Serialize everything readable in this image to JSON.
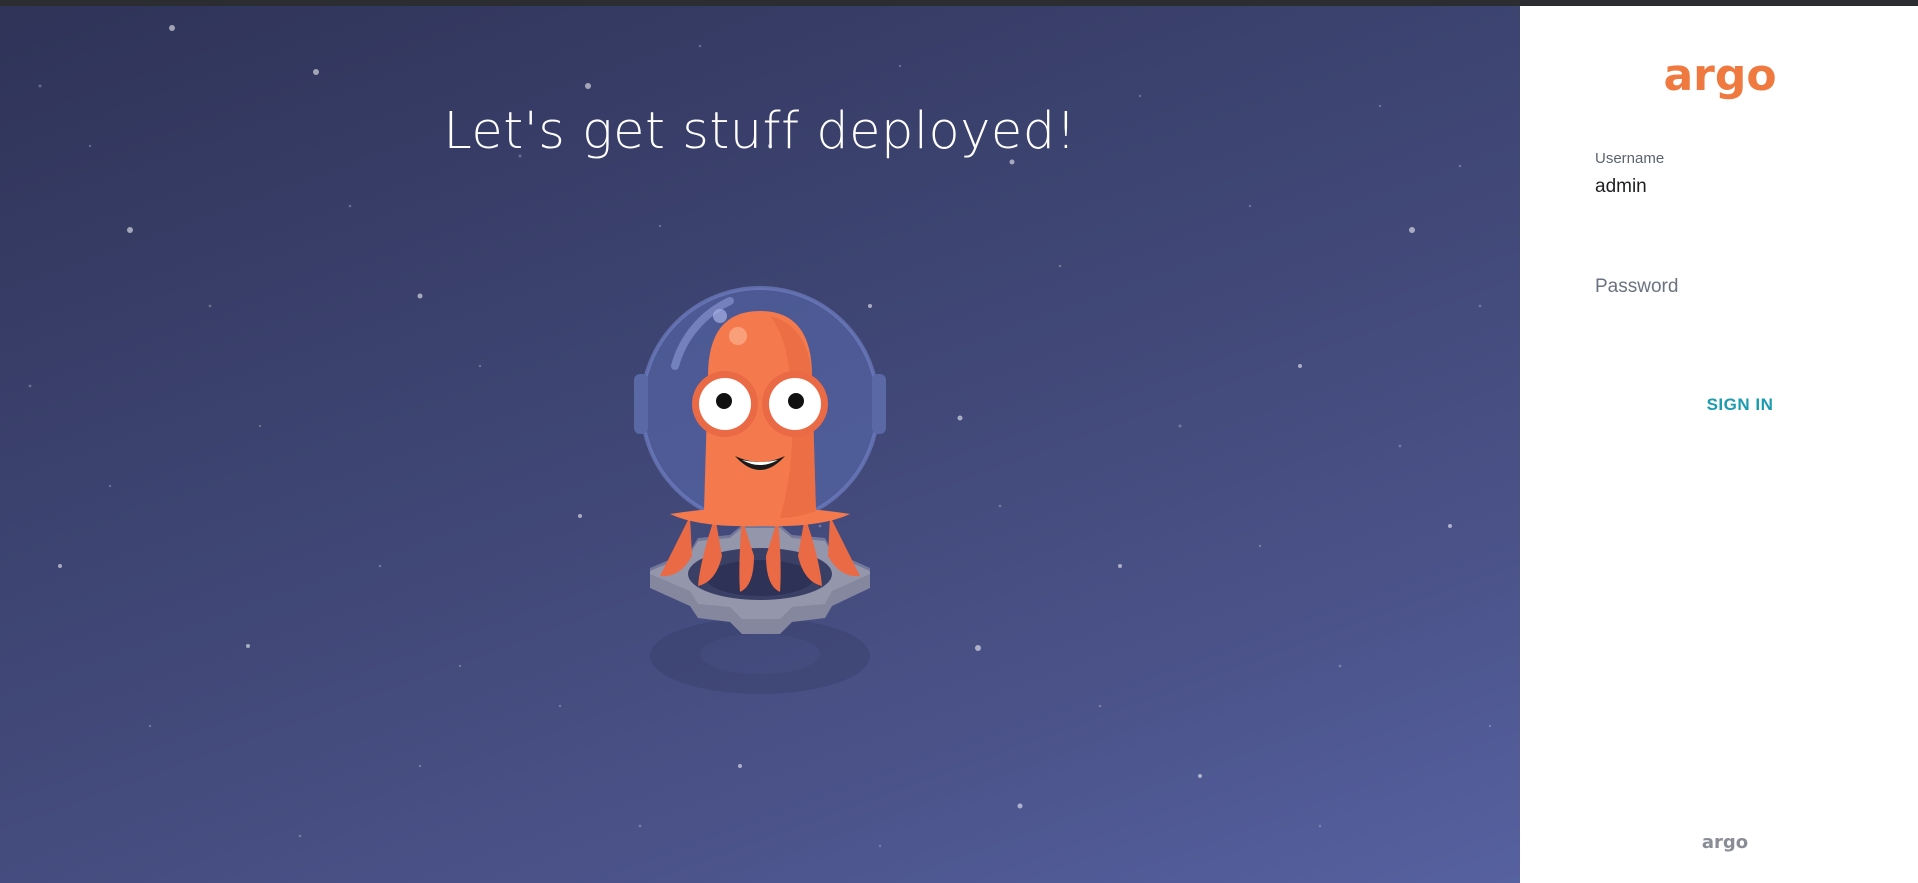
{
  "hero": {
    "headline": "Let's get stuff deployed!"
  },
  "login": {
    "username_label": "Username",
    "username_value": "admin",
    "password_placeholder": "Password",
    "signin_label": "SIGN IN"
  },
  "branding": {
    "logo_text": "argo",
    "footer_logo_text": "argo",
    "brand_color": "#f0793f",
    "accent_color": "#1a9bb0"
  }
}
